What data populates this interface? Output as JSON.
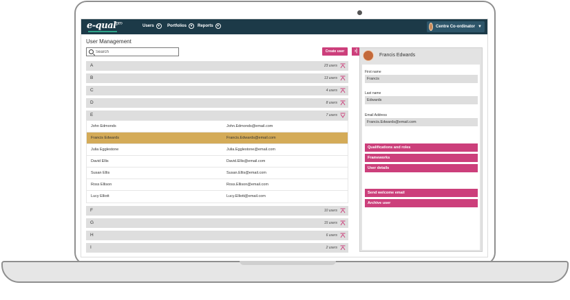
{
  "nav": {
    "logo": "e-qual",
    "logo_suffix": "pro",
    "items": [
      {
        "label": "Users"
      },
      {
        "label": "Portfolios"
      },
      {
        "label": "Reports"
      }
    ],
    "user_role": "Centre Co-ordinator",
    "caret": "▼"
  },
  "page": {
    "title": "User Management",
    "search_placeholder": "Search",
    "create_user_label": "Create user",
    "collapse_label": "›|"
  },
  "groups_before": [
    {
      "letter": "A",
      "count": "23 users"
    },
    {
      "letter": "B",
      "count": "13 users"
    },
    {
      "letter": "C",
      "count": "4 users"
    },
    {
      "letter": "D",
      "count": "8 users"
    }
  ],
  "open_group": {
    "letter": "E",
    "count": "7 users",
    "rows": [
      {
        "name": "John Edmonds",
        "email": "John.Edmonds@email.com"
      },
      {
        "name": "Francis Edwards",
        "email": "Francis.Edwards@email.com"
      },
      {
        "name": "Julia Egglestone",
        "email": "Julia.Egglestone@email.com"
      },
      {
        "name": "David Ellis",
        "email": "David.Ellis@email.com"
      },
      {
        "name": "Susan Ellis",
        "email": "Susan.Ellis@email.com"
      },
      {
        "name": "Ross Ellison",
        "email": "Ross.Ellison@email.com"
      },
      {
        "name": "Lucy Elliott",
        "email": "Lucy.Elliott@email.com"
      }
    ]
  },
  "groups_after": [
    {
      "letter": "F",
      "count": "10 users"
    },
    {
      "letter": "G",
      "count": "15 users"
    },
    {
      "letter": "H",
      "count": "6 users"
    },
    {
      "letter": "I",
      "count": "2 users"
    }
  ],
  "panel": {
    "name": "Francis Edwards",
    "first_name_label": "First name",
    "first_name": "Francis",
    "last_name_label": "Last name",
    "last_name": "Edwards",
    "email_label": "Email Address",
    "email": "Francis.Edwards@email.com",
    "actions": [
      "Qualifications and roles",
      "Frameworks",
      "User details"
    ],
    "actions2": [
      "Send welcome email",
      "Archive user"
    ]
  },
  "colors": {
    "nav_bg": "#1c3a48",
    "accent": "#cc3f7b",
    "selected_row": "#d4ab58"
  }
}
